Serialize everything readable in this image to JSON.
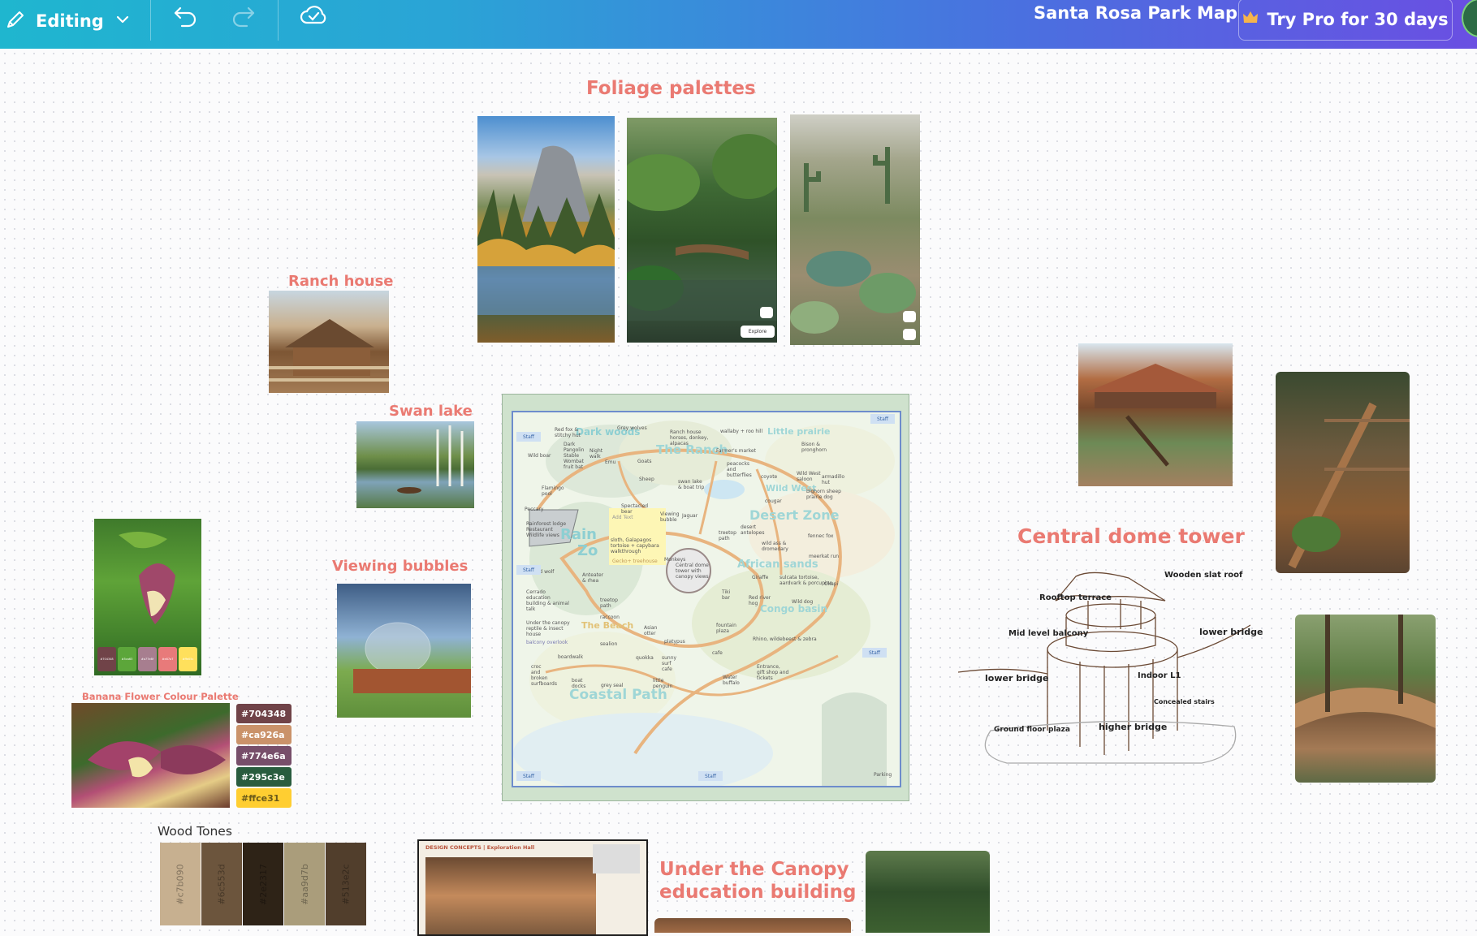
{
  "topbar": {
    "mode_label": "Editing",
    "doc_title": "Santa Rosa Park Map",
    "pro_label": "Try Pro for 30 days"
  },
  "board": {
    "foliage_title": "Foliage palettes",
    "ranch_title": "Ranch house",
    "swan_title": "Swan lake",
    "bubbles_title": "Viewing bubbles",
    "dome_title": "Central dome tower",
    "canopy_title_line1": "Under the Canopy",
    "canopy_title_line2": "education building",
    "banana_title": "Banana Flower Colour Palette",
    "wood_title": "Wood Tones",
    "explore_label": "Explore",
    "design_concepts_label": "DESIGN CONCEPTS | Exploration Hall"
  },
  "banana_swatches": [
    {
      "label": "#704348",
      "color": "#704348"
    },
    {
      "label": "#ca926a",
      "color": "#ca926a"
    },
    {
      "label": "#774e6a",
      "color": "#774e6a"
    },
    {
      "label": "#295c3e",
      "color": "#295c3e"
    },
    {
      "label": "#ffce31",
      "color": "#ffce31"
    }
  ],
  "banana_mini_swatches": [
    {
      "label": "#704348",
      "color": "#704348"
    },
    {
      "label": "#5ca63",
      "color": "#5ca63a"
    },
    {
      "label": "#a77e8f",
      "color": "#a77e8f"
    },
    {
      "label": "#e87a7",
      "color": "#e87a7a"
    },
    {
      "label": "#ffe05c",
      "color": "#ffe05c"
    }
  ],
  "wood_tones": [
    {
      "label": "#c7b090",
      "color": "#c7b090"
    },
    {
      "label": "#6c553d",
      "color": "#6c553d"
    },
    {
      "label": "#2e2317",
      "color": "#2e2317"
    },
    {
      "label": "#aa9d7b",
      "color": "#aa9d7b"
    },
    {
      "label": "#513e2c",
      "color": "#513e2c"
    }
  ],
  "map": {
    "zones": {
      "dark_woods": "Dark woods",
      "the_ranch": "The Ranch",
      "little_prairie": "Little prairie",
      "wild_west": "Wild West",
      "desert_zone": "Desert Zone",
      "rainforest": "Rain",
      "rainforest2": "Zo",
      "african_sands": "African sands",
      "congo_basin": "Congo basin",
      "the_beach": "The Beach",
      "coastal_path": "Coastal Path"
    },
    "labels": {
      "red_fox": "Red fox &\nstitchy hut",
      "grey_wolves": "Grey wolves",
      "ranch_house": "Ranch house\nhorses, donkey,\nalpacas",
      "wallaby": "wallaby + roo hill",
      "wild_boar": "Wild boar",
      "dark_stuff": "Dark\nPangolin\nStable\nWombat\nfruit bat",
      "night_walk": "Night\nwalk",
      "emu": "Emu",
      "goats": "Goats",
      "farmers_market": "Farmer's market",
      "peacocks": "peacocks\nand\nbutterflies",
      "coyote": "coyote",
      "wild_west_saloon": "Wild West\nsaloon",
      "armadillo": "armadillo\nhut",
      "sheep": "Sheep",
      "swan_lake": "swan lake\n& boat trip",
      "bighorn": "bighorn sheep\nprairie dog",
      "bison": "Bison &\npronghorn",
      "cougar": "cougar",
      "flamingo": "Flamingo\npool",
      "peccary": "Peccary",
      "rainforest_lodge": "Rainforest lodge\nRestaurant\nWildlife views",
      "spectacled_bear": "Spectacled\nbear",
      "add_text": "Add Text",
      "viewing_bubble": "Viewing\nbubble",
      "jaguar": "Jaguar",
      "desert_antelopes": "desert\nantelopes",
      "treetop_path": "treetop\npath",
      "fennec_fox": "fennec fox",
      "wild_ass": "wild ass &\ndromedary",
      "meerkat": "meerkat run",
      "sloth": "sloth, Galapagos\ntortoise + capybara\nwalkthrough",
      "monkeys": "Monkeys",
      "gecko": "Gecko+ treehouse",
      "central_dome": "Central dome\ntower with\ncanopy views",
      "maned_wolf": "Maned wolf",
      "anteater": "Anteater\n& rhea",
      "giraffe": "Giraffe",
      "sulcata": "sulcata tortoise,\naardvark & porcupine",
      "okapi": "Okapi",
      "cerrado": "Cerrado\neducation\nbuilding & animal\ntalk",
      "treetop_path2": "treetop\npath",
      "tiki_bar": "Tiki\nbar",
      "red_river_hog": "Red river\nhog",
      "wild_dog": "Wild dog",
      "raccoon": "raccoon",
      "under_canopy": "Under the canopy\nreptile & insect\nhouse",
      "balcony": "balcony overlook",
      "asian_otter": "Asian\notter",
      "fountain": "fountain\nplaza",
      "rhino": "Rhino, wildebeest & zebra",
      "seal": "sealion",
      "boardwalk": "boardwalk",
      "platypus": "platypus",
      "quokka": "quokka",
      "sunny_cafe": "sunny\nsurf\ncafe",
      "cafe": "cafe",
      "entrance": "Entrance,\ngift shop and\ntickets",
      "croc": "croc\nand\nbroken\nsurfboards",
      "boat_docks": "boat\ndocks",
      "grey_seal": "grey seal",
      "little_penguin": "little\npenguin",
      "water_buffalo": "Water\nbuffalo",
      "parking": "Parking"
    },
    "staff_label": "Staff"
  },
  "sketch_labels": {
    "wooden_slat_roof": "Wooden slat roof",
    "rooftop_terrace": "Rooftop terrace",
    "mid_level_balcony": "Mid level balcony",
    "lower_bridge_right": "lower bridge",
    "lower_bridge_left": "lower bridge",
    "indoor_l1": "Indoor L1",
    "concealed_stairs": "Concealed stairs",
    "higher_bridge": "higher bridge",
    "ground_floor_plaza": "Ground floor plaza"
  },
  "colors": {
    "heading": "#ea7a72",
    "map_zone_text": "#8ecfd2",
    "map_zone_text_alt": "#e2c277"
  }
}
